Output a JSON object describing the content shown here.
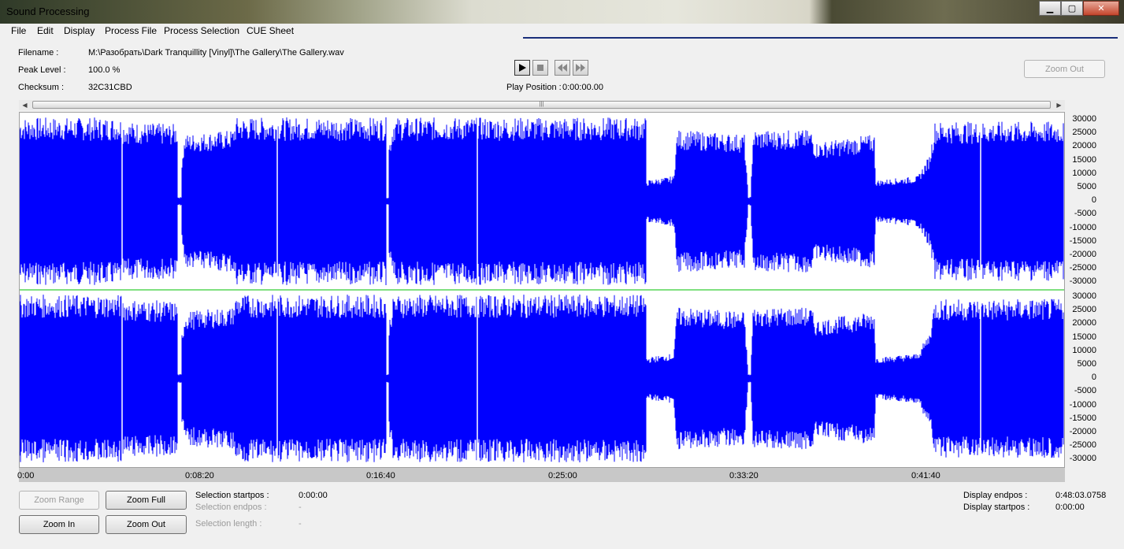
{
  "window": {
    "title": "Sound Processing"
  },
  "menu": [
    "File",
    "Edit",
    "Display",
    "Process File",
    "Process Selection",
    "CUE Sheet"
  ],
  "info": {
    "filename_label": "Filename :",
    "filename_value": "M:\\Разобрать\\Dark Tranquillity [Vinyl]\\The Gallery\\The Gallery.wav",
    "peak_label": "Peak Level :",
    "peak_value": "100.0 %",
    "checksum_label": "Checksum :",
    "checksum_value": "32C31CBD"
  },
  "playback": {
    "position_label": "Play Position :",
    "position_value": "0:00:00.00"
  },
  "buttons": {
    "zoom_out_top": "Zoom Out",
    "zoom_range": "Zoom Range",
    "zoom_full": "Zoom Full",
    "zoom_in": "Zoom In",
    "zoom_out_bottom": "Zoom Out"
  },
  "selection": {
    "startpos_label": "Selection startpos :",
    "startpos_value": "0:00:00",
    "endpos_label": "Selection endpos :",
    "endpos_value": "-",
    "length_label": "Selection length :",
    "length_value": "-"
  },
  "display": {
    "endpos_label": "Display endpos :",
    "endpos_value": "0:48:03.0758",
    "startpos_label": "Display startpos :",
    "startpos_value": "0:00:00"
  },
  "timeline": [
    "0:00",
    "0:08:20",
    "0:16:40",
    "0:25:00",
    "0:33:20",
    "0:41:40"
  ],
  "amplitude_axis": [
    "30000",
    "25000",
    "20000",
    "15000",
    "10000",
    "5000",
    "0",
    "-5000",
    "-10000",
    "-15000",
    "-20000",
    "-25000",
    "-30000"
  ],
  "colors": {
    "waveform": "#0000ff",
    "channel_divider": "#00c000",
    "background": "#ffffff"
  }
}
